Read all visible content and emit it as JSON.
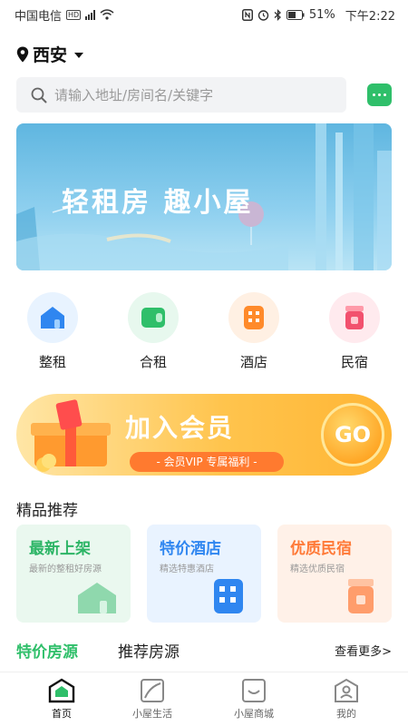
{
  "status_bar": {
    "carrier": "中国电信",
    "hd": "HD",
    "battery": "51%",
    "time": "下午2:22"
  },
  "location": {
    "city": "西安"
  },
  "search": {
    "placeholder": "请输入地址/房间名/关键字"
  },
  "banner": {
    "text": "轻租房 趣小屋"
  },
  "categories": [
    {
      "label": "整租",
      "icon": "house-icon",
      "color": "#2f86f0",
      "bg": "#e8f3ff"
    },
    {
      "label": "合租",
      "icon": "shared-room-icon",
      "color": "#2fbf6a",
      "bg": "#e7f8ee"
    },
    {
      "label": "酒店",
      "icon": "hotel-icon",
      "color": "#ff8a2a",
      "bg": "#fff0e3"
    },
    {
      "label": "民宿",
      "icon": "homestay-icon",
      "color": "#f2516e",
      "bg": "#ffeaee"
    }
  ],
  "vip": {
    "title": "加入会员",
    "subtitle": "- 会员VIP 专属福利 -",
    "go": "GO"
  },
  "featured": {
    "title": "精品推荐",
    "cards": [
      {
        "title": "最新上架",
        "subtitle": "最新的整租好房源",
        "color": "#2db566",
        "bg": "#eaf8ef"
      },
      {
        "title": "特价酒店",
        "subtitle": "精选特惠酒店",
        "color": "#2f86f0",
        "bg": "#e9f3ff"
      },
      {
        "title": "优质民宿",
        "subtitle": "精选优质民宿",
        "color": "#ff7a38",
        "bg": "#fff1e8"
      }
    ]
  },
  "listing_tabs": {
    "tab1": "特价房源",
    "tab2": "推荐房源",
    "more": "查看更多>"
  },
  "bottom_nav": [
    {
      "label": "首页",
      "icon": "home-icon",
      "active": true
    },
    {
      "label": "小屋生活",
      "icon": "life-icon",
      "active": false
    },
    {
      "label": "小屋商城",
      "icon": "shop-icon",
      "active": false
    },
    {
      "label": "我的",
      "icon": "profile-icon",
      "active": false
    }
  ],
  "colors": {
    "accent": "#2fbf6a",
    "vip": "#ffb534"
  }
}
